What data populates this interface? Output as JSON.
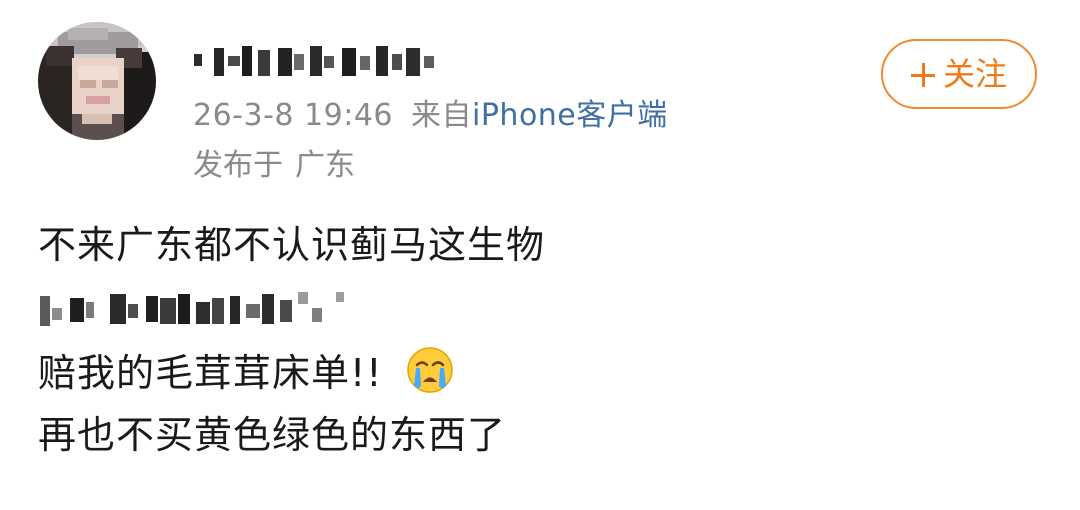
{
  "post": {
    "meta": {
      "date": "26-3-8 19:46",
      "source_prefix": "来自",
      "source": "iPhone客户端"
    },
    "location": {
      "prefix": "发布于",
      "place": "广东"
    },
    "follow_label": "关注",
    "content": {
      "line1": "不来广东都不认识蓟马这生物",
      "line3": "赔我的毛茸茸床单!!",
      "line4": "再也不买黄色绿色的东西了"
    }
  },
  "icons": {
    "avatar": "avatar-pixelated",
    "emoji": "crying-face-icon",
    "follow_plus": "plus-icon"
  },
  "colors": {
    "accent": "#f07a16",
    "link": "#3f6fa3",
    "meta_text": "#8a8a8a",
    "body_text": "#1a1a1a"
  }
}
